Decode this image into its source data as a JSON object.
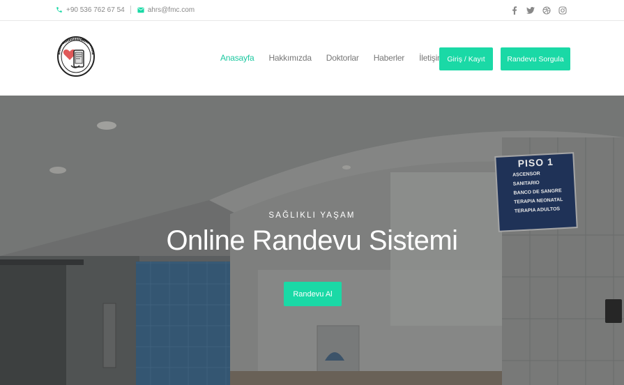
{
  "topbar": {
    "phone": "+90 536 762 67 54",
    "email": "ahrs@fmc.com",
    "social_icons": [
      "facebook-icon",
      "twitter-icon",
      "dribbble-icon",
      "instagram-icon"
    ]
  },
  "nav": {
    "items": [
      {
        "label": "Anasayfa",
        "active": true
      },
      {
        "label": "Hakkımızda",
        "active": false
      },
      {
        "label": "Doktorlar",
        "active": false
      },
      {
        "label": "Haberler",
        "active": false
      },
      {
        "label": "İletişim",
        "active": false
      }
    ],
    "login_label": "Giriş / Kayıt",
    "query_label": "Randevu Sorgula"
  },
  "hero": {
    "kicker": "SAĞLIKLI YAŞAM",
    "title": "Online Randevu Sistemi",
    "button_label": "Randevu Al",
    "sign_title": "PISO 1",
    "sign_lines": [
      "ASCENSOR",
      "SANITARIO",
      "BANCO DE SANGRE",
      "TERAPIA NEONATAL",
      "TERAPIA ADULTOS"
    ]
  },
  "colors": {
    "accent": "#1ad9a6",
    "active_nav": "#1cc8a0"
  }
}
